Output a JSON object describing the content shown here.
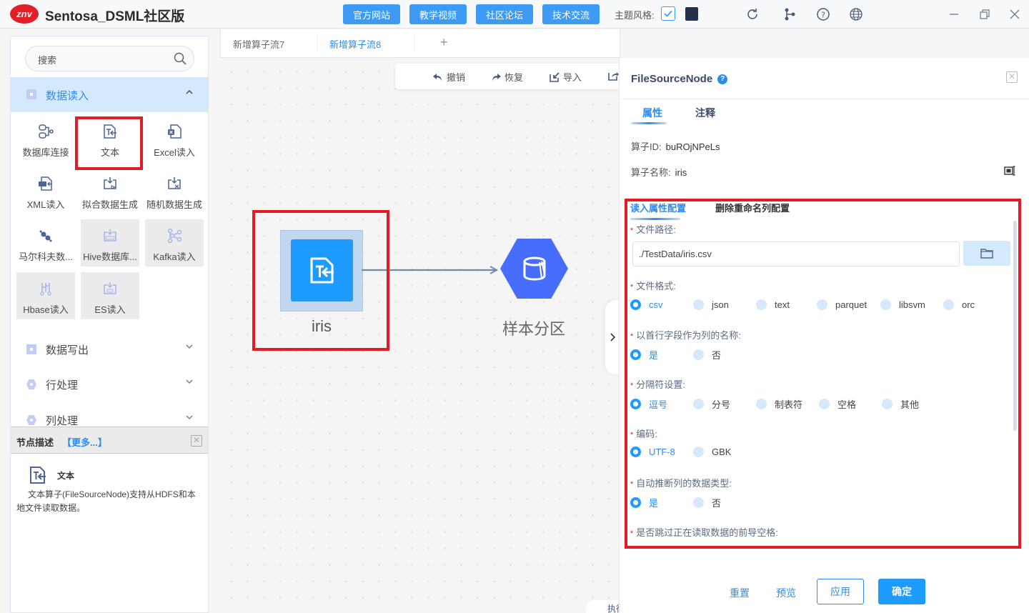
{
  "app": {
    "logo_text": "znv",
    "title": "Sentosa_DSML社区版"
  },
  "header": {
    "links": [
      "官方网站",
      "教学视频",
      "社区论坛",
      "技术交流"
    ],
    "theme_label": "主题风格:",
    "theme_options": [
      {
        "name": "light",
        "checked": true
      },
      {
        "name": "dark",
        "color": "#27304a",
        "checked": false
      }
    ],
    "icons": [
      "refresh-icon",
      "branch-icon",
      "help-icon",
      "globe-icon"
    ],
    "window_controls": [
      "minimize",
      "restore",
      "close"
    ]
  },
  "sidebar": {
    "search_placeholder": "搜索",
    "open_category": {
      "label": "数据读入",
      "items": [
        {
          "label": "数据库连接",
          "icon": "database-connect-icon",
          "enabled": true
        },
        {
          "label": "文本",
          "icon": "text-file-icon",
          "enabled": true,
          "highlighted": true
        },
        {
          "label": "Excel读入",
          "icon": "excel-file-icon",
          "enabled": true
        },
        {
          "label": "XML读入",
          "icon": "xml-file-icon",
          "enabled": true
        },
        {
          "label": "拟合数据生成",
          "icon": "fit-data-icon",
          "enabled": true
        },
        {
          "label": "随机数据生成",
          "icon": "random-data-icon",
          "enabled": true
        },
        {
          "label": "马尔科夫数...",
          "icon": "markov-icon",
          "enabled": true
        },
        {
          "label": "Hive数据库...",
          "icon": "hive-icon",
          "enabled": false
        },
        {
          "label": "Kafka读入",
          "icon": "kafka-icon",
          "enabled": false
        },
        {
          "label": "Hbase读入",
          "icon": "hbase-icon",
          "enabled": false
        },
        {
          "label": "ES读入",
          "icon": "es-icon",
          "enabled": false
        }
      ]
    },
    "categories": [
      {
        "label": "数据写出"
      },
      {
        "label": "行处理"
      },
      {
        "label": "列处理"
      }
    ],
    "description": {
      "title": "节点描述",
      "more": "【更多...】",
      "node_name": "文本",
      "text": "文本算子(FileSourceNode)支持从HDFS和本地文件读取数据。"
    }
  },
  "tabs": {
    "items": [
      {
        "label": "新增算子流7",
        "active": false
      },
      {
        "label": "新增算子流8",
        "active": true
      }
    ],
    "add_label": "+"
  },
  "toolbar": {
    "undo": "撤销",
    "redo": "恢复",
    "import": "导入"
  },
  "canvas": {
    "nodes": [
      {
        "label": "iris",
        "type": "FileSourceNode",
        "selected": true
      },
      {
        "label": "样本分区",
        "type": "partition"
      }
    ],
    "edges": [
      {
        "from": "iris",
        "to": "样本分区"
      }
    ],
    "bottom_tab_partial": "执行"
  },
  "panel": {
    "title": "FileSourceNode",
    "help": "?",
    "tabs": [
      {
        "label": "属性",
        "active": true
      },
      {
        "label": "注释",
        "active": false
      }
    ],
    "node_id_label": "算子ID:",
    "node_id": "buROjNPeLs",
    "node_name_label": "算子名称:",
    "node_name": "iris",
    "sub_tabs": [
      {
        "label": "读入属性配置",
        "active": true
      },
      {
        "label": "删除重命名列配置",
        "active": false
      }
    ],
    "form": {
      "file_path": {
        "label": "文件路径:",
        "value": "./TestData/iris.csv"
      },
      "file_format": {
        "label": "文件格式:",
        "options": [
          "csv",
          "json",
          "text",
          "parquet",
          "libsvm",
          "orc"
        ],
        "selected": "csv"
      },
      "header": {
        "label": "以首行字段作为列的名称:",
        "options": [
          "是",
          "否"
        ],
        "selected": "是"
      },
      "delimiter": {
        "label": "分隔符设置:",
        "options": [
          "逗号",
          "分号",
          "制表符",
          "空格",
          "其他"
        ],
        "selected": "逗号"
      },
      "encoding": {
        "label": "编码:",
        "options": [
          "UTF-8",
          "GBK"
        ],
        "selected": "UTF-8"
      },
      "infer_schema": {
        "label": "自动推断列的数据类型:",
        "options": [
          "是",
          "否"
        ],
        "selected": "是"
      },
      "skip_leading_space": {
        "label": "是否跳过正在读取数据的前导空格:"
      }
    },
    "buttons": {
      "reset": "重置",
      "preview": "预览",
      "apply": "应用",
      "confirm": "确定"
    }
  }
}
